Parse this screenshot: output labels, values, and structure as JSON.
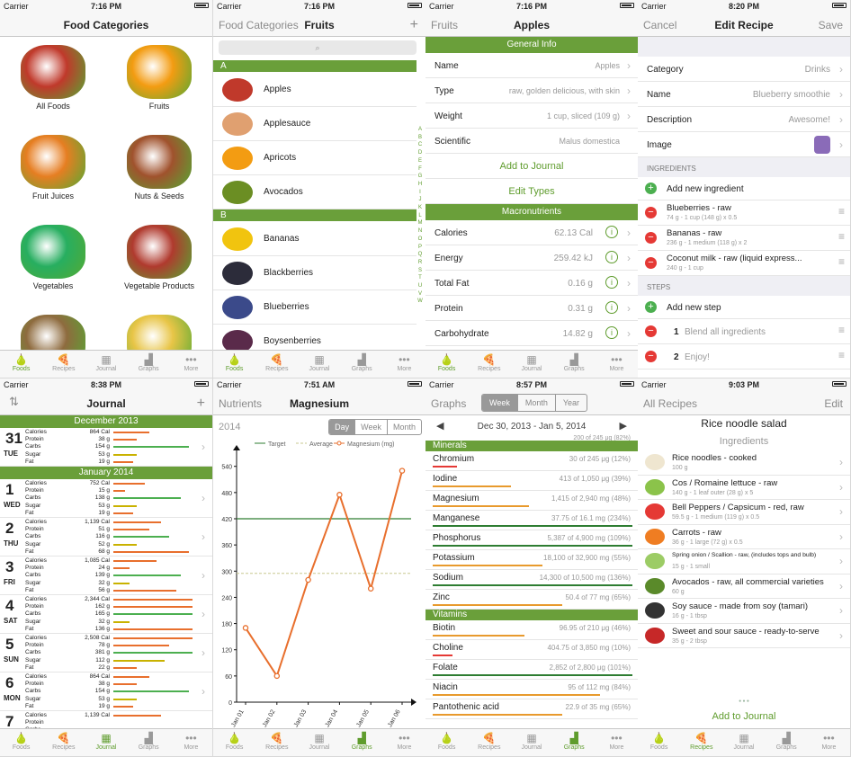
{
  "status": {
    "carrier": "Carrier",
    "times": [
      "7:16 PM",
      "7:16 PM",
      "7:16 PM",
      "8:20 PM",
      "8:38 PM",
      "7:51 AM",
      "8:57 PM",
      "9:03 PM"
    ]
  },
  "colors": {
    "accent": "#5f9c2d",
    "header": "#6a9f3a",
    "orange": "#e86f2d",
    "red": "#e53935"
  },
  "tabs": [
    {
      "label": "Foods",
      "icon": "pear-icon"
    },
    {
      "label": "Recipes",
      "icon": "pizza-icon"
    },
    {
      "label": "Journal",
      "icon": "calendar-icon"
    },
    {
      "label": "Graphs",
      "icon": "graph-icon"
    },
    {
      "label": "More",
      "icon": "more-icon"
    }
  ],
  "p1": {
    "title": "Food Categories",
    "categories": [
      "All Foods",
      "Fruits",
      "Fruit Juices",
      "Nuts & Seeds",
      "Vegetables",
      "Vegetable Products",
      "",
      ""
    ]
  },
  "p2": {
    "back": "Food Categories",
    "title": "Fruits",
    "plus": "+",
    "sectionA": "A",
    "sectionB": "B",
    "itemsA": [
      "Apples",
      "Applesauce",
      "Apricots",
      "Avocados"
    ],
    "itemsB": [
      "Bananas",
      "Blackberries",
      "Blueberries",
      "Boysenberries"
    ],
    "index": [
      "A",
      "B",
      "C",
      "D",
      "E",
      "F",
      "G",
      "H",
      "I",
      "J",
      "K",
      "L",
      "M",
      "N",
      "O",
      "P",
      "Q",
      "R",
      "S",
      "T",
      "U",
      "V",
      "W"
    ]
  },
  "p3": {
    "back": "Fruits",
    "title": "Apples",
    "general": "General Info",
    "rows": [
      {
        "k": "Name",
        "v": "Apples"
      },
      {
        "k": "Type",
        "v": "raw, golden delicious, with skin"
      },
      {
        "k": "Weight",
        "v": "1 cup, sliced (109 g)"
      },
      {
        "k": "Scientific",
        "v": "Malus domestica"
      }
    ],
    "add": "Add to Journal",
    "edit": "Edit Types",
    "macro": "Macronutrients",
    "macros": [
      {
        "k": "Calories",
        "v": "62.13 Cal"
      },
      {
        "k": "Energy",
        "v": "259.42 kJ"
      },
      {
        "k": "Total Fat",
        "v": "0.16 g"
      },
      {
        "k": "Protein",
        "v": "0.31 g"
      },
      {
        "k": "Carbohydrate",
        "v": "14.82 g"
      }
    ]
  },
  "p4": {
    "cancel": "Cancel",
    "title": "Edit Recipe",
    "save": "Save",
    "rows": [
      {
        "k": "Category",
        "v": "Drinks"
      },
      {
        "k": "Name",
        "v": "Blueberry smoothie"
      },
      {
        "k": "Description",
        "v": "Awesome!"
      },
      {
        "k": "Image",
        "v": ""
      }
    ],
    "ingHeader": "INGREDIENTS",
    "addIng": "Add new ingredient",
    "ingredients": [
      {
        "n": "Blueberries - raw",
        "d": "74 g - 1 cup (148 g) x 0.5"
      },
      {
        "n": "Bananas - raw",
        "d": "236 g - 1 medium  (118 g) x 2"
      },
      {
        "n": "Coconut milk - raw (liquid express...",
        "d": "240 g - 1 cup"
      }
    ],
    "stepsHeader": "STEPS",
    "addStep": "Add new step",
    "steps": [
      {
        "n": "1",
        "t": "Blend all ingredients"
      },
      {
        "n": "2",
        "t": "Enjoy!"
      }
    ]
  },
  "p5": {
    "title": "Journal",
    "dec": "December 2013",
    "jan": "January 2014",
    "labels": [
      "Calories",
      "Protein",
      "Carbs",
      "Sugar",
      "Fat"
    ],
    "days": [
      {
        "d": "31",
        "w": "TUE",
        "v": [
          "864 Cal",
          "38 g",
          "154 g",
          "53 g",
          "19 g"
        ],
        "b": [
          0.45,
          0.3,
          0.95,
          0.3,
          0.25
        ]
      },
      {
        "d": "1",
        "w": "WED",
        "v": [
          "752 Cal",
          "15 g",
          "138 g",
          "53 g",
          "19 g"
        ],
        "b": [
          0.4,
          0.15,
          0.85,
          0.3,
          0.25
        ]
      },
      {
        "d": "2",
        "w": "THU",
        "v": [
          "1,139 Cal",
          "51 g",
          "116 g",
          "52 g",
          "68 g"
        ],
        "b": [
          0.6,
          0.45,
          0.7,
          0.3,
          0.95
        ]
      },
      {
        "d": "3",
        "w": "FRI",
        "v": [
          "1,085 Cal",
          "24 g",
          "139 g",
          "32 g",
          "56 g"
        ],
        "b": [
          0.55,
          0.2,
          0.85,
          0.2,
          0.8
        ]
      },
      {
        "d": "4",
        "w": "SAT",
        "v": [
          "2,344 Cal",
          "162 g",
          "165 g",
          "32 g",
          "136 g"
        ],
        "b": [
          1,
          1,
          1,
          0.2,
          1
        ]
      },
      {
        "d": "5",
        "w": "SUN",
        "v": [
          "2,508 Cal",
          "78 g",
          "381 g",
          "112 g",
          "22 g"
        ],
        "b": [
          1,
          0.7,
          1,
          0.65,
          0.3
        ]
      },
      {
        "d": "6",
        "w": "MON",
        "v": [
          "864 Cal",
          "38 g",
          "154 g",
          "53 g",
          "19 g"
        ],
        "b": [
          0.45,
          0.3,
          0.95,
          0.3,
          0.25
        ]
      },
      {
        "d": "7",
        "w": "",
        "v": [
          "1,139 Cal",
          "",
          "",
          "",
          ""
        ],
        "b": [
          0.6,
          0,
          0,
          0,
          0
        ]
      }
    ]
  },
  "p6": {
    "back": "Nutrients",
    "title": "Magnesium",
    "year": "2014",
    "seg": [
      "Day",
      "Week",
      "Month"
    ]
  },
  "chart_data": {
    "type": "line",
    "title": "",
    "legend": [
      "Target",
      "Average",
      "Magnesium (mg)"
    ],
    "categories": [
      "Jan 01",
      "Jan 02",
      "Jan 03",
      "Jan 04",
      "Jan 05",
      "Jan 06"
    ],
    "series": [
      {
        "name": "Magnesium (mg)",
        "values": [
          170,
          60,
          280,
          475,
          260,
          530
        ]
      }
    ],
    "target": 420,
    "average": 295,
    "ylim": [
      0,
      560
    ],
    "yticks": [
      0,
      60,
      120,
      180,
      240,
      300,
      360,
      420,
      480,
      540
    ]
  },
  "p7": {
    "back": "Graphs",
    "seg": [
      "Week",
      "Month",
      "Year"
    ],
    "range": "Dec 30, 2013 - Jan 5, 2014",
    "minerals": "Minerals",
    "vitamins": "Vitamins",
    "top": "200 of 245 μg (82%)",
    "mineralRows": [
      {
        "k": "Chromium",
        "v": "30 of 245 μg (12%)",
        "p": 0.12
      },
      {
        "k": "Iodine",
        "v": "413 of 1,050 μg (39%)",
        "p": 0.39
      },
      {
        "k": "Magnesium",
        "v": "1,415 of 2,940 mg (48%)",
        "p": 0.48
      },
      {
        "k": "Manganese",
        "v": "37.75 of 16.1 mg (234%)",
        "p": 1
      },
      {
        "k": "Phosphorus",
        "v": "5,387 of 4,900 mg (109%)",
        "p": 1
      },
      {
        "k": "Potassium",
        "v": "18,100 of 32,900 mg (55%)",
        "p": 0.55
      },
      {
        "k": "Sodium",
        "v": "14,300 of 10,500 mg (136%)",
        "p": 1
      },
      {
        "k": "Zinc",
        "v": "50.4 of 77 mg (65%)",
        "p": 0.65
      }
    ],
    "vitaminRows": [
      {
        "k": "Biotin",
        "v": "96.95 of 210 μg (46%)",
        "p": 0.46
      },
      {
        "k": "Choline",
        "v": "404.75 of 3,850 mg (10%)",
        "p": 0.1
      },
      {
        "k": "Folate",
        "v": "2,852 of 2,800 μg (101%)",
        "p": 1
      },
      {
        "k": "Niacin",
        "v": "95 of 112 mg (84%)",
        "p": 0.84
      },
      {
        "k": "Pantothenic acid",
        "v": "22.9 of 35 mg (65%)",
        "p": 0.65
      }
    ]
  },
  "p8": {
    "back": "All Recipes",
    "edit": "Edit",
    "title": "Rice noodle salad",
    "sub": "Ingredients",
    "add": "Add to Journal",
    "items": [
      {
        "n": "Rice noodles - cooked",
        "d": "100 g"
      },
      {
        "n": "Cos / Romaine lettuce - raw",
        "d": "140 g - 1 leaf outer (28 g) x 5"
      },
      {
        "n": "Bell Peppers / Capsicum - red, raw",
        "d": "59.5 g - 1 medium  (119 g) x 0.5"
      },
      {
        "n": "Carrots - raw",
        "d": "36 g - 1 large  (72 g) x 0.5"
      },
      {
        "n": "Spring onion / Scallion - raw, (includes tops and bulb)",
        "d": "15 g - 1 small"
      },
      {
        "n": "Avocados - raw, all commercial varieties",
        "d": "60 g"
      },
      {
        "n": "Soy sauce - made from soy (tamari)",
        "d": "16 g - 1 tbsp"
      },
      {
        "n": "Sweet and sour sauce - ready-to-serve",
        "d": "35 g - 2 tbsp"
      }
    ]
  }
}
